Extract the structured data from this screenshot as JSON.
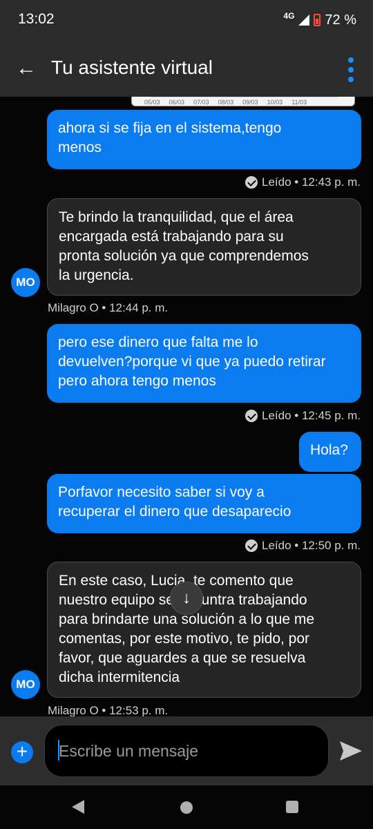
{
  "status_bar": {
    "time": "13:02",
    "network": "4G",
    "battery": "72 %"
  },
  "app_bar": {
    "title": "Tu asistente virtual",
    "back_icon": "arrow-left-icon",
    "menu_icon": "more-vert-icon"
  },
  "peek": {
    "dates": [
      "05/03",
      "06/03",
      "07/03",
      "08/03",
      "09/03",
      "10/03",
      "11/03"
    ]
  },
  "messages": [
    {
      "direction": "out",
      "text": "ahora si se fija en el sistema,tengo\nmenos",
      "receipt": "Leído • 12:43 p. m."
    },
    {
      "direction": "in",
      "text": "Te brindo la tranquilidad, que el área\nencargada está trabajando para su\npronta solución ya que comprendemos\nla urgencia.",
      "avatar": "MO",
      "sender": "Milagro O • 12:44 p. m."
    },
    {
      "direction": "out",
      "text": "pero ese dinero que falta me lo\ndevuelven?porque vi que ya puedo retirar\npero ahora tengo menos",
      "receipt": "Leído • 12:45 p. m."
    },
    {
      "direction": "out",
      "text": "Hola?"
    },
    {
      "direction": "out",
      "text": "Porfavor necesito saber si voy a\nrecuperar el dinero que desaparecio",
      "receipt": "Leído • 12:50 p. m."
    },
    {
      "direction": "in",
      "text": "En este caso, Lucia, te comento que\nnuestro equipo se encuntra trabajando\npara brindarte una solución a lo que me\ncomentas, por este motivo, te pido, por\nfavor, que aguardes a que se resuelva\ndicha intermitencia",
      "avatar": "MO",
      "sender": "Milagro O • 12:53 p. m."
    }
  ],
  "composer": {
    "placeholder": "Escribe un mensaje",
    "add_icon": "plus-circle-icon",
    "send_icon": "send-icon"
  },
  "colors": {
    "accent": "#0a7cf0",
    "background": "#050505",
    "bar": "#2b2b2b"
  }
}
